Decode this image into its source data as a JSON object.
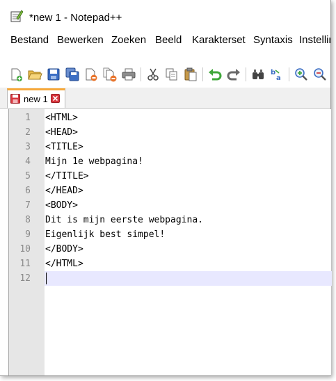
{
  "window": {
    "title": "*new 1 - Notepad++"
  },
  "menu": [
    "Bestand",
    "Bewerken",
    "Zoeken",
    "Beeld",
    "Karakterset",
    "Syntaxis",
    "Instellingen"
  ],
  "toolbar_icons": [
    "new-file-icon",
    "open-file-icon",
    "save-icon",
    "save-all-icon",
    "close-icon",
    "close-all-icon",
    "print-icon",
    "cut-icon",
    "copy-icon",
    "paste-icon",
    "undo-icon",
    "redo-icon",
    "find-icon",
    "replace-icon",
    "zoom-in-icon",
    "zoom-out-icon"
  ],
  "tab": {
    "label": "new 1"
  },
  "editor": {
    "lines": [
      "<HTML>",
      "<HEAD>",
      "<TITLE>",
      "Mijn 1e webpagina!",
      "</TITLE>",
      "</HEAD>",
      "<BODY>",
      "Dit is mijn eerste webpagina.",
      "Eigenlijk best simpel!",
      "</BODY>",
      "</HTML>",
      ""
    ],
    "line_numbers": [
      "1",
      "2",
      "3",
      "4",
      "5",
      "6",
      "7",
      "8",
      "9",
      "10",
      "11",
      "12"
    ],
    "current_line": 12
  },
  "colors": {
    "tab_accent": "#f6a83a",
    "gutter": "#e6e6e6",
    "current_line": "#e8e8ff"
  }
}
